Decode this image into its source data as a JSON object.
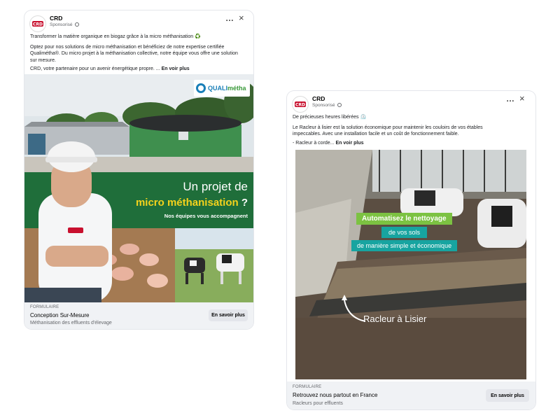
{
  "ads": [
    {
      "brand": "CRD",
      "sponsored": "Sponsorisé",
      "more_icon": "…",
      "close_icon": "×",
      "headline": "Transformer la matière organique en biogaz grâce à la micro méthanisation ♻️",
      "body_lines": [
        "Optez pour nos solutions de micro méthanisation et bénéficiez de notre expertise certifiée",
        "Qualiméthа®. Du micro projet à la méthanisation collective, notre équipe vous offre une solution",
        "sur mesure."
      ],
      "teaser": "CRD, votre partenaire pour un avenir énergétique propre. ...",
      "see_more": "En voir plus",
      "creative": {
        "badge_prefix": "QUALI",
        "badge_suffix": "métha",
        "line1": "Un projet de",
        "line2": "micro méthanisation",
        "line2_tail": " ?",
        "line3": "Nos équipes vous accompagnent",
        "helmet_logo": "CRD"
      },
      "footer": {
        "category": "FORMULAIRE",
        "title": "Conception Sur-Mesure",
        "subtitle": "Méthanisation des effluents d'élevage",
        "cta": "En savoir plus"
      }
    },
    {
      "brand": "CRD",
      "sponsored": "Sponsorisé",
      "more_icon": "…",
      "close_icon": "×",
      "headline": "De précieuses heures libérées ⏲️",
      "body_lines": [
        "Le Racleur à lisier est la solution économique pour maintenir les couloirs de vos étables",
        "impeccables. Avec une installation facile et un coût de fonctionnement faible."
      ],
      "teaser": "- Racleur à corde...",
      "see_more": "En voir plus",
      "creative": {
        "tag1": "Automatisez le nettoyage",
        "tag2": "de vos sols",
        "tag3": "de manière simple et économique",
        "caption": "Racleur à Lisier"
      },
      "footer": {
        "category": "FORMULAIRE",
        "title": "Retrouvez nous partout en France",
        "subtitle": "Racleurs pour effluents",
        "cta": "En savoir plus"
      }
    }
  ]
}
